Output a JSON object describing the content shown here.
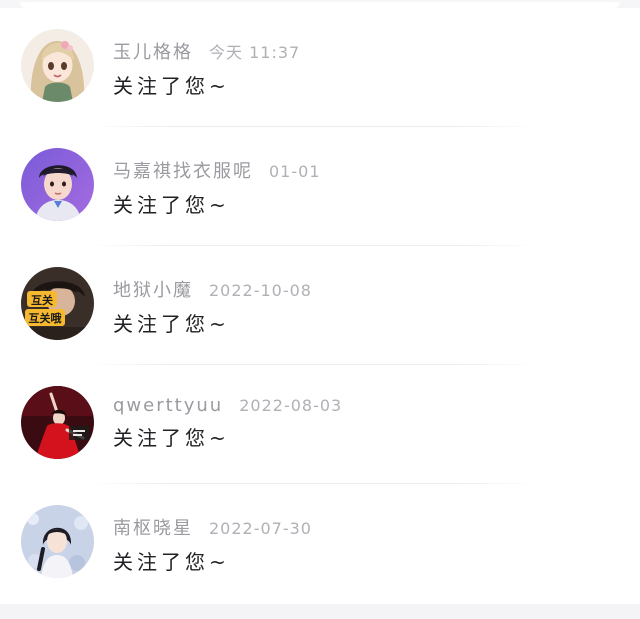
{
  "notifications": [
    {
      "avatar_icon": "anime-girl-avatar",
      "username": "玉儿格格",
      "time": "今天 11:37",
      "message": "关注了您~"
    },
    {
      "avatar_icon": "boy-portrait-avatar",
      "username": "马嘉祺找衣服呢",
      "time": "01-01",
      "message": "关注了您~"
    },
    {
      "avatar_icon": "mutual-follow-sticker-avatar",
      "avatar_text_line1": "互关",
      "avatar_text_line2": "互关哦",
      "username": "地狱小魔",
      "time": "2022-10-08",
      "message": "关注了您~"
    },
    {
      "avatar_icon": "red-dress-dancer-avatar",
      "username": "qwerttyuu",
      "time": "2022-08-03",
      "message": "关注了您~"
    },
    {
      "avatar_icon": "girl-with-flowers-avatar",
      "username": "南枢晓星",
      "time": "2022-07-30",
      "message": "关注了您~"
    }
  ],
  "colors": {
    "background": "#ffffff",
    "username": "#9a9aa0",
    "time": "#b0b0b6",
    "message": "#222226",
    "divider": "#ececef"
  }
}
